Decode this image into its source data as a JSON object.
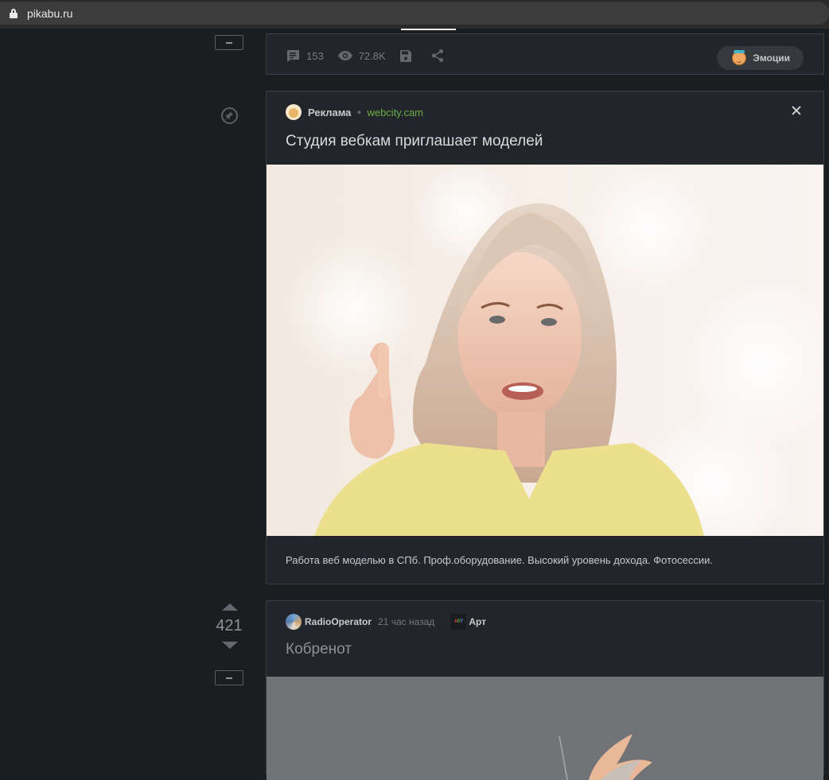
{
  "browser": {
    "url": "pikabu.ru"
  },
  "top_post": {
    "comments": "153",
    "views": "72.8K",
    "emotions_label": "Эмоции"
  },
  "ad": {
    "label": "Реклама",
    "domain": "webcity.cam",
    "title": "Студия вебкам приглашает моделей",
    "description": "Работа веб моделью в СПб. Проф.оборудование. Высокий уровень дохода. Фотосессии."
  },
  "post": {
    "rating": "421",
    "author": "RadioOperator",
    "time": "21 час назад",
    "community": "Арт",
    "community_badge": [
      "A",
      "R",
      "T"
    ],
    "title": "Кобренот"
  }
}
